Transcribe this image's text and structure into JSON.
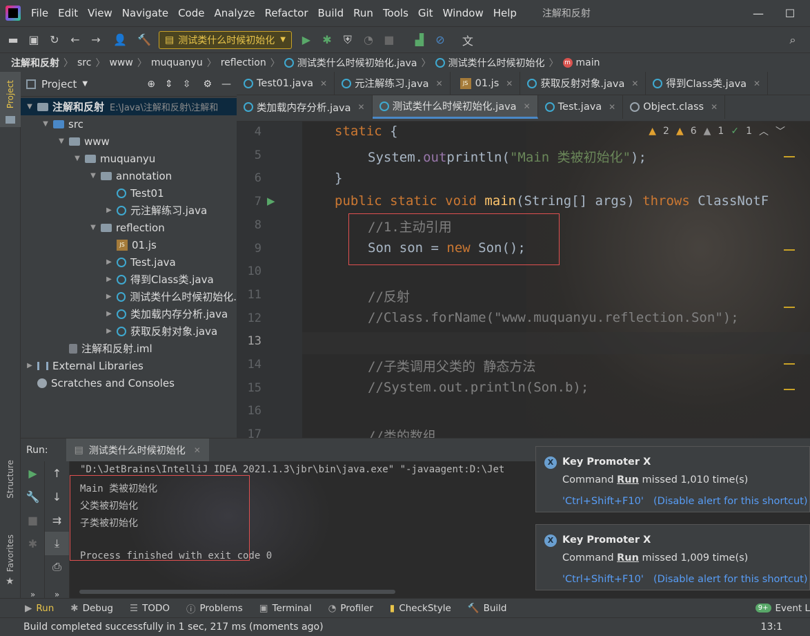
{
  "menu": {
    "items": [
      "File",
      "Edit",
      "View",
      "Navigate",
      "Code",
      "Analyze",
      "Refactor",
      "Build",
      "Run",
      "Tools",
      "Git",
      "Window",
      "Help"
    ],
    "window_title": "注解和反射",
    "minimize": "—",
    "maximize": "☐"
  },
  "toolbar": {
    "run_config": "测试类什么时候初始化"
  },
  "breadcrumb": [
    "注解和反射",
    "src",
    "www",
    "muquanyu",
    "reflection",
    "测试类什么时候初始化.java",
    "测试类什么时候初始化",
    "main"
  ],
  "sidebar": {
    "project_label": "Project",
    "structure_label": "Structure",
    "favorites_label": "Favorites"
  },
  "project": {
    "title": "Project",
    "tree": [
      {
        "label": "注解和反射",
        "suffix": "E:\\Java\\注解和反射\\注解和",
        "kind": "folder",
        "depth": 0,
        "arrow": "▾"
      },
      {
        "label": "src",
        "kind": "folder",
        "depth": 1,
        "arrow": "▾"
      },
      {
        "label": "www",
        "kind": "folder",
        "depth": 2,
        "arrow": "▾"
      },
      {
        "label": "muquanyu",
        "kind": "folder",
        "depth": 3,
        "arrow": "▾"
      },
      {
        "label": "annotation",
        "kind": "folder",
        "depth": 4,
        "arrow": "▾"
      },
      {
        "label": "Test01",
        "kind": "class",
        "depth": 5,
        "arrow": ""
      },
      {
        "label": "元注解练习.java",
        "kind": "class",
        "depth": 5,
        "arrow": "›"
      },
      {
        "label": "reflection",
        "kind": "folder",
        "depth": 4,
        "arrow": "▾"
      },
      {
        "label": "01.js",
        "kind": "js",
        "depth": 5,
        "arrow": ""
      },
      {
        "label": "Test.java",
        "kind": "class",
        "depth": 5,
        "arrow": "›"
      },
      {
        "label": "得到Class类.java",
        "kind": "class",
        "depth": 5,
        "arrow": "›"
      },
      {
        "label": "测试类什么时候初始化.",
        "kind": "class",
        "depth": 5,
        "arrow": "›"
      },
      {
        "label": "类加载内存分析.java",
        "kind": "class",
        "depth": 5,
        "arrow": "›"
      },
      {
        "label": "获取反射对象.java",
        "kind": "class",
        "depth": 5,
        "arrow": "›"
      },
      {
        "label": "注解和反射.iml",
        "kind": "iml",
        "depth": 2,
        "arrow": ""
      },
      {
        "label": "External Libraries",
        "kind": "lib",
        "depth": 0,
        "arrow": "›"
      },
      {
        "label": "Scratches and Consoles",
        "kind": "scratch",
        "depth": 0,
        "arrow": ""
      }
    ]
  },
  "tabs": {
    "row1": [
      "Test01.java",
      "元注解练习.java",
      "01.js",
      "获取反射对象.java",
      "得到Class类.java"
    ],
    "row2": [
      "类加载内存分析.java",
      "测试类什么时候初始化.java",
      "Test.java",
      "Object.class"
    ],
    "active": "测试类什么时候初始化.java"
  },
  "inspections": {
    "warn1": "2",
    "warn2": "6",
    "weak": "1",
    "ok": "1"
  },
  "editor": {
    "line_numbers": [
      "4",
      "5",
      "6",
      "7",
      "8",
      "9",
      "10",
      "11",
      "12",
      "13",
      "14",
      "15",
      "16",
      "17"
    ],
    "current_line": "13",
    "l4a": "static ",
    "l4b": "{",
    "l5a": "System.",
    "l5b": "out",
    ".": ".",
    "l5c": "println",
    "l5d": "(",
    "l5e": "\"Main 类被初始化\"",
    "l5f": ");",
    "l6": "}",
    "l7a": "public static void ",
    "l7b": "main",
    "l7c": "(String[] args) ",
    "l7d": "throws ",
    "l7e": "ClassNotF",
    "l8": "//1.主动引用",
    "l9a": "Son son = ",
    "l9b": "new ",
    "l9c": "Son();",
    "l11": "//反射",
    "l12": "//Class.forName(\"www.muquanyu.reflection.Son\");",
    "l14": "//子类调用父类的 静态方法",
    "l15": "//System.out.println(Son.b);",
    "l17": "//类的数组"
  },
  "run": {
    "label": "Run:",
    "config": "测试类什么时候初始化",
    "console": [
      "\"D:\\JetBrains\\IntelliJ IDEA 2021.1.3\\jbr\\bin\\java.exe\" \"-javaagent:D:\\Jet",
      "Main 类被初始化",
      "父类被初始化",
      "子类被初始化",
      "",
      "Process finished with exit code 0"
    ]
  },
  "notifications": [
    {
      "title": "Key Promoter X",
      "pre": "Command ",
      "cmd": "Run",
      "post": " missed 1,010 time(s)",
      "shortcut": "'Ctrl+Shift+F10'",
      "disable": "(Disable alert for this shortcut)"
    },
    {
      "title": "Key Promoter X",
      "pre": "Command ",
      "cmd": "Run",
      "post": " missed 1,009 time(s)",
      "shortcut": "'Ctrl+Shift+F10'",
      "disable": "(Disable alert for this shortcut)"
    }
  ],
  "bottom_tools": [
    "Run",
    "Debug",
    "TODO",
    "Problems",
    "Terminal",
    "Profiler",
    "CheckStyle",
    "Build"
  ],
  "event_log": {
    "badge": "9+",
    "label": "Event L"
  },
  "status": {
    "message": "Build completed successfully in 1 sec, 217 ms (moments ago)",
    "position": "13:1"
  },
  "colors": {
    "keyword": "#cc7832",
    "string": "#6a8759",
    "comment": "#808080",
    "method": "#ffc66d",
    "field": "#9876aa",
    "link": "#589df6",
    "run_config": "#e8c44a"
  }
}
